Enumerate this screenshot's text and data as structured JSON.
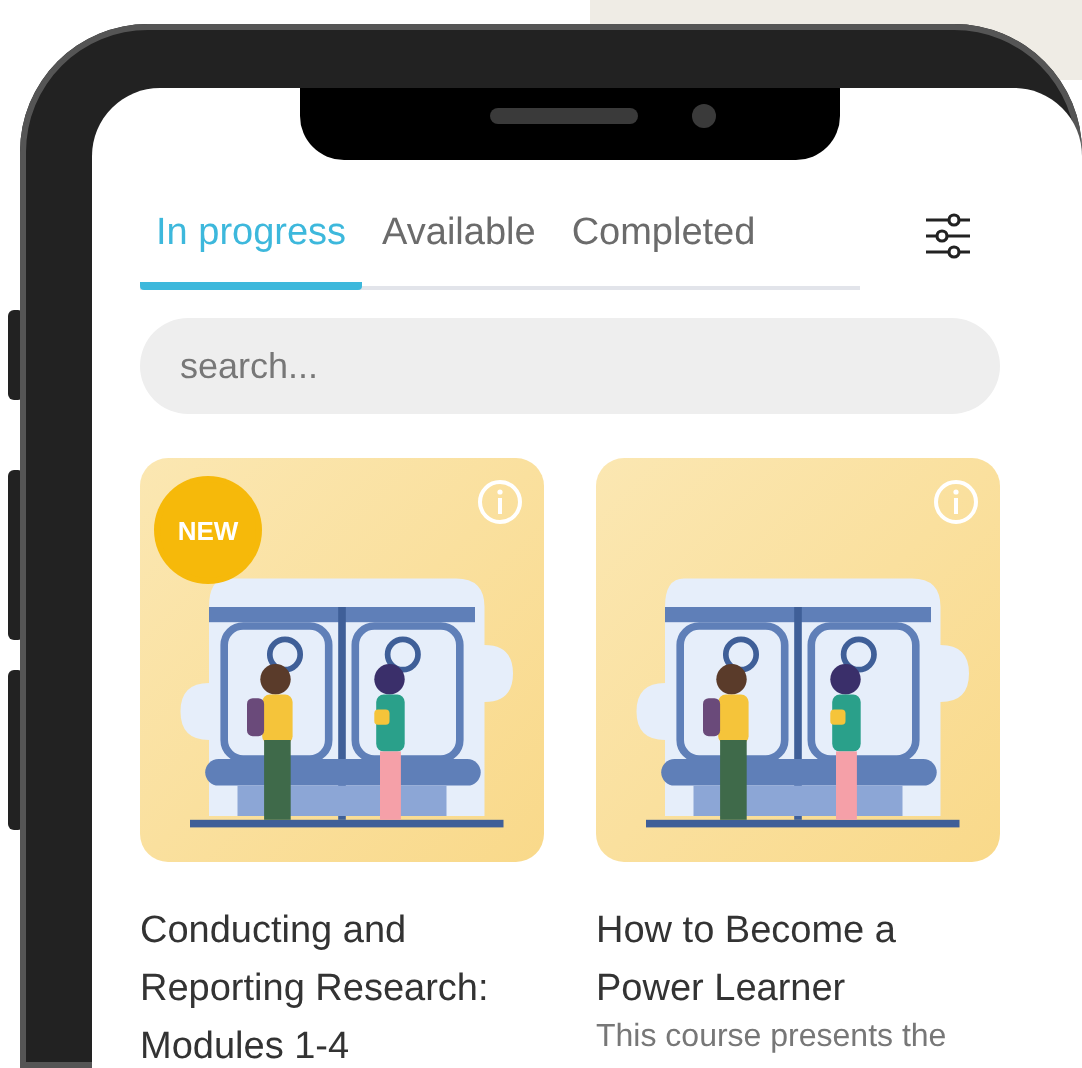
{
  "tabs": [
    {
      "label": "In progress",
      "selected": true
    },
    {
      "label": "Available",
      "selected": false
    },
    {
      "label": "Completed",
      "selected": false
    }
  ],
  "search": {
    "placeholder": "search..."
  },
  "courses": [
    {
      "title": "Conducting and Reporting Research: Modules 1-4",
      "is_new": true,
      "badge": "NEW"
    },
    {
      "title": "How to Become a Power Learner",
      "is_new": false,
      "description": "This course presents the"
    }
  ]
}
